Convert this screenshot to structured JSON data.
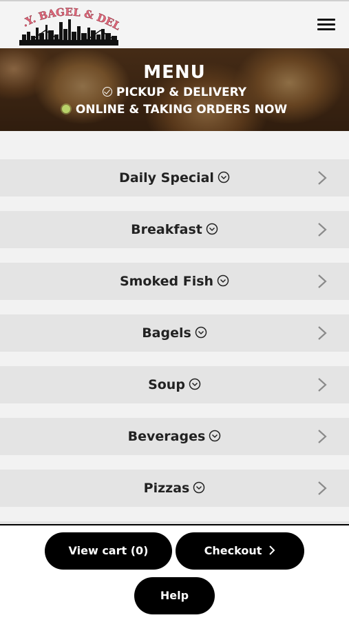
{
  "logo": {
    "text": "N.Y. BAGEL & DELI"
  },
  "header": {
    "menu_icon": "hamburger-icon"
  },
  "hero": {
    "title": "MENU",
    "line1": "PICKUP & DELIVERY",
    "line2": "ONLINE & TAKING ORDERS NOW",
    "status_color": "#b9d36a"
  },
  "categories": [
    {
      "label": "Daily Special"
    },
    {
      "label": "Breakfast"
    },
    {
      "label": "Smoked Fish"
    },
    {
      "label": "Bagels"
    },
    {
      "label": "Soup"
    },
    {
      "label": "Beverages"
    },
    {
      "label": "Pizzas"
    }
  ],
  "footer": {
    "view_cart": "View cart (0)",
    "checkout": "Checkout",
    "help": "Help"
  }
}
